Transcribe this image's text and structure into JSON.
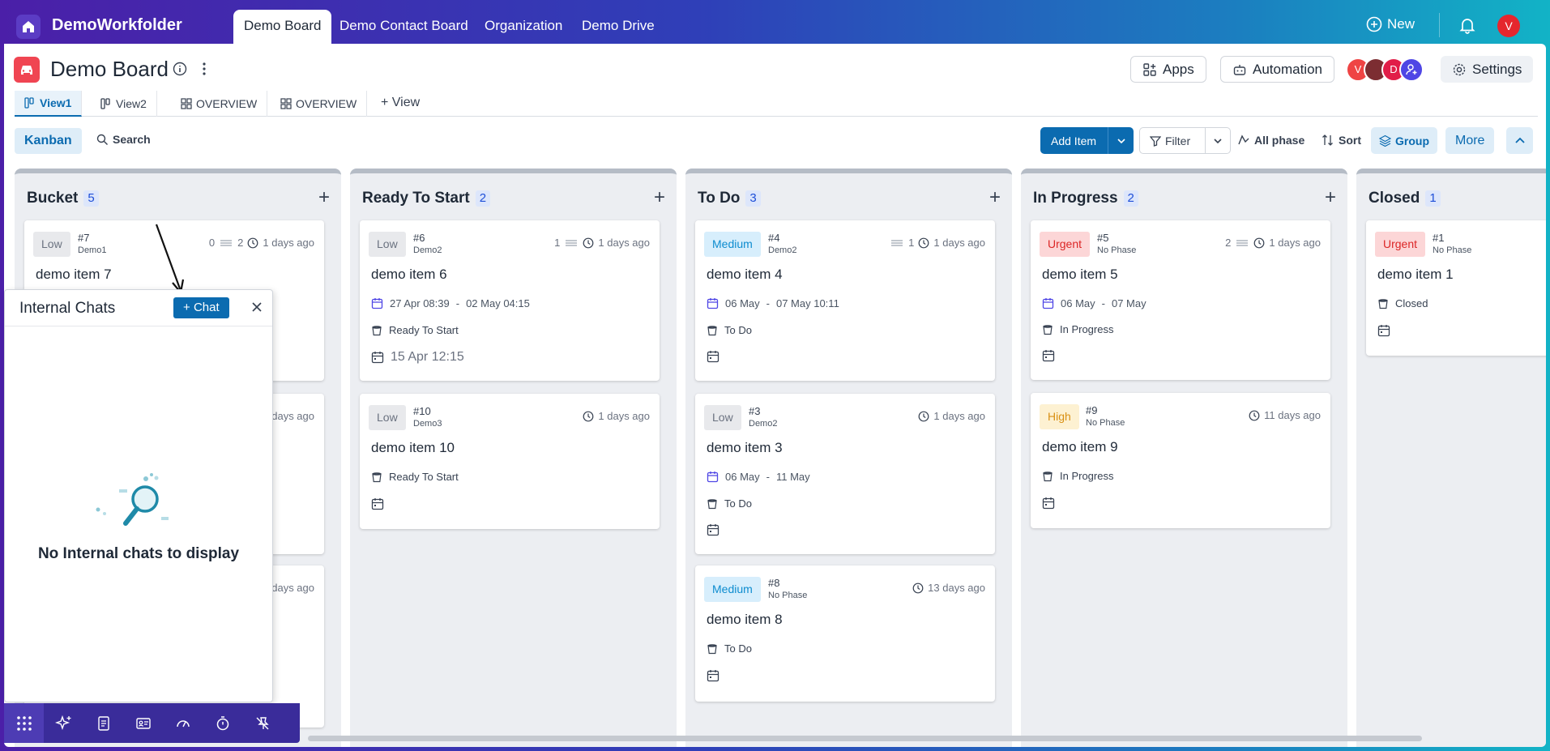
{
  "app": {
    "name": "DemoWorkfolder"
  },
  "nav": {
    "tabs": [
      {
        "label": "Demo Board"
      },
      {
        "label": "Demo Contact Board"
      },
      {
        "label": "Organization"
      },
      {
        "label": "Demo Drive"
      }
    ]
  },
  "topbar": {
    "new_label": "New",
    "user_initial": "V"
  },
  "board": {
    "title": "Demo Board"
  },
  "header_buttons": {
    "apps": "Apps",
    "automation": "Automation",
    "settings": "Settings"
  },
  "members": [
    {
      "initial": "V",
      "color": "#ef4444"
    },
    {
      "initial": "",
      "color": "#7c2d32"
    },
    {
      "initial": "D",
      "color": "#e11d48"
    },
    {
      "initial": "",
      "color": "#4f46e5"
    }
  ],
  "views": {
    "tabs": [
      {
        "label": "View1"
      },
      {
        "label": "View2"
      },
      {
        "label": "OVERVIEW"
      },
      {
        "label": "OVERVIEW"
      }
    ],
    "add_label": "View"
  },
  "toolbar": {
    "kanban": "Kanban",
    "search": "Search",
    "add_item": "Add Item",
    "filter": "Filter",
    "all_phase": "All phase",
    "sort": "Sort",
    "group": "Group",
    "more": "More"
  },
  "columns": [
    {
      "name": "Bucket",
      "count": "5",
      "cards": [
        {
          "priority": "Low",
          "id": "#7",
          "sub": "Demo1",
          "counts": "0",
          "sub_count": "2",
          "ago": "1 days ago",
          "title": "demo item 7"
        },
        {
          "ago": "days ago"
        },
        {
          "ago": "days ago"
        }
      ]
    },
    {
      "name": "Ready To Start",
      "count": "2",
      "cards": [
        {
          "priority": "Low",
          "id": "#6",
          "sub": "Demo2",
          "counts": "1",
          "ago": "1 days ago",
          "title": "demo item 6",
          "date_start": "27 Apr 08:39",
          "date_end": "02 May 04:15",
          "phase": "Ready To Start",
          "due": "15 Apr 12:15"
        },
        {
          "priority": "Low",
          "id": "#10",
          "sub": "Demo3",
          "ago": "1 days ago",
          "title": "demo item 10",
          "phase": "Ready To Start"
        }
      ]
    },
    {
      "name": "To Do",
      "count": "3",
      "cards": [
        {
          "priority": "Medium",
          "id": "#4",
          "sub": "Demo2",
          "counts": "1",
          "ago": "1 days ago",
          "title": "demo item 4",
          "date_start": "06 May",
          "date_end": "07 May 10:11",
          "phase": "To Do"
        },
        {
          "priority": "Low",
          "id": "#3",
          "sub": "Demo2",
          "ago": "1 days ago",
          "title": "demo item 3",
          "date_start": "06 May",
          "date_end": "11 May",
          "phase": "To Do"
        },
        {
          "priority": "Medium",
          "id": "#8",
          "sub": "No Phase",
          "ago": "13 days ago",
          "title": "demo item 8",
          "phase": "To Do"
        }
      ]
    },
    {
      "name": "In Progress",
      "count": "2",
      "cards": [
        {
          "priority": "Urgent",
          "id": "#5",
          "sub": "No Phase",
          "counts": "2",
          "ago": "1 days ago",
          "title": "demo item 5",
          "date_start": "06 May",
          "date_end": "07 May",
          "phase": "In Progress"
        },
        {
          "priority": "High",
          "id": "#9",
          "sub": "No Phase",
          "ago": "11 days ago",
          "title": "demo item 9",
          "phase": "In Progress"
        }
      ]
    },
    {
      "name": "Closed",
      "count": "1",
      "cards": [
        {
          "priority": "Urgent",
          "id": "#1",
          "sub": "No Phase",
          "title": "demo item 1",
          "phase": "Closed"
        }
      ]
    }
  ],
  "chat": {
    "title": "Internal Chats",
    "button": "Chat",
    "empty": "No Internal chats to display"
  },
  "colors": {
    "accent": "#0b6bb0",
    "low": "#6b7280",
    "medium": "#0d8ccf",
    "urgent": "#dc2626",
    "high": "#d99014"
  }
}
